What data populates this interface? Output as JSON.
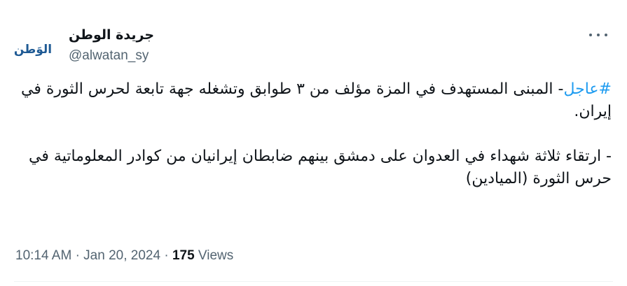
{
  "author": {
    "display_name": "جريدة الوطن",
    "handle": "@alwatan_sy",
    "avatar_logo_text": "الوَطن"
  },
  "tweet": {
    "hashtag": "#عاجل",
    "line1_rest": "- المبنى المستهدف في المزة مؤلف من ٣ طوابق وتشغله جهة تابعة لحرس الثورة في إيران.",
    "line2": "- ارتقاء ثلاثة شهداء في العدوان على دمشق بينهم ضابطان إيرانيان من كوادر المعلوماتية في حرس الثورة (الميادين)"
  },
  "meta": {
    "time": "10:14 AM",
    "separator": "·",
    "date": "Jan 20, 2024",
    "views_count": "175",
    "views_label": "Views"
  },
  "icons": {
    "more": "more-horizontal-icon"
  },
  "colors": {
    "accent": "#1d9bf0",
    "text": "#0f1419",
    "muted": "#536471",
    "logo_blue": "#1f5a94"
  }
}
